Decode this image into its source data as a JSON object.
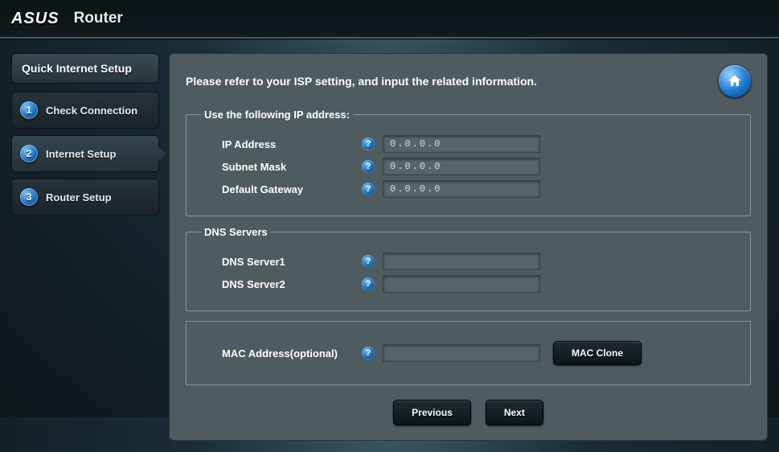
{
  "brand": {
    "logo": "ASUS",
    "title": "Router"
  },
  "sidebar": {
    "header": "Quick Internet Setup",
    "steps": [
      {
        "num": "1",
        "label": "Check Connection"
      },
      {
        "num": "2",
        "label": "Internet Setup"
      },
      {
        "num": "3",
        "label": "Router Setup"
      }
    ],
    "active_index": 1
  },
  "panel": {
    "title": "Please refer to your ISP setting, and input the related information.",
    "fieldset_ip_legend": "Use the following IP address:",
    "fieldset_dns_legend": "DNS Servers",
    "labels": {
      "ip": "IP Address",
      "subnet": "Subnet Mask",
      "gateway": "Default Gateway",
      "dns1": "DNS Server1",
      "dns2": "DNS Server2",
      "mac": "MAC Address(optional)"
    },
    "values": {
      "ip": "0.0.0.0",
      "subnet": "0.0.0.0",
      "gateway": "0.0.0.0",
      "dns1": "",
      "dns2": "",
      "mac": ""
    },
    "buttons": {
      "mac_clone": "MAC Clone",
      "previous": "Previous",
      "next": "Next"
    },
    "help_glyph": "?"
  }
}
